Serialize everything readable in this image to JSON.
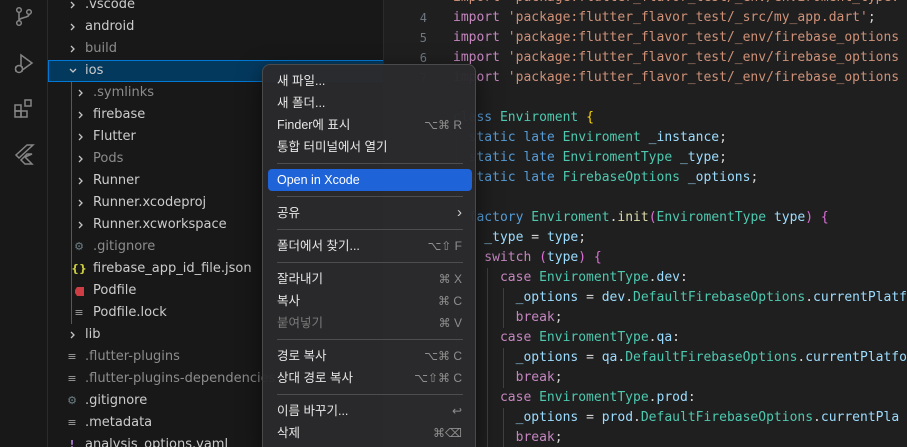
{
  "activity_bar": {
    "icons": [
      "source-control-icon",
      "run-debug-icon",
      "extensions-icon",
      "flutter-icon"
    ]
  },
  "explorer": {
    "items": [
      {
        "label": ".vscode"
      },
      {
        "label": "android"
      },
      {
        "label": "build"
      },
      {
        "label": "ios"
      },
      {
        "label": ".symlinks"
      },
      {
        "label": "firebase"
      },
      {
        "label": "Flutter"
      },
      {
        "label": "Pods"
      },
      {
        "label": "Runner"
      },
      {
        "label": "Runner.xcodeproj"
      },
      {
        "label": "Runner.xcworkspace"
      },
      {
        "label": ".gitignore",
        "icon": "⚙"
      },
      {
        "label": "firebase_app_id_file.json",
        "icon": "{}"
      },
      {
        "label": "Podfile"
      },
      {
        "label": "Podfile.lock",
        "icon": "≡"
      },
      {
        "label": "lib"
      },
      {
        "label": ".flutter-plugins",
        "icon": "≡"
      },
      {
        "label": ".flutter-plugins-dependencies",
        "icon": "≡"
      },
      {
        "label": ".gitignore",
        "icon": "⚙"
      },
      {
        "label": ".metadata",
        "icon": "≡"
      },
      {
        "label": "analysis_options.yaml",
        "icon": "!"
      }
    ]
  },
  "editor": {
    "line_numbers": [
      "4",
      "5",
      "6",
      "7"
    ],
    "lines": [
      [
        {
          "t": "import 'package:flutter_flavor_test/_env/enviroment_type.",
          "c": "st"
        }
      ],
      [
        {
          "t": "import ",
          "c": "kc"
        },
        {
          "t": "'package:flutter_flavor_test/_src/my_app.dart'",
          "c": "st"
        },
        {
          "t": ";",
          "c": "pn"
        }
      ],
      [
        {
          "t": "import ",
          "c": "kc"
        },
        {
          "t": "'package:flutter_flavor_test/_env/firebase_options",
          "c": "st"
        }
      ],
      [
        {
          "t": "import ",
          "c": "kc"
        },
        {
          "t": "'package:flutter_flavor_test/_env/firebase_options",
          "c": "st"
        }
      ],
      [
        {
          "t": "import ",
          "c": "kc"
        },
        {
          "t": "'package:flutter_flavor_test/_env/firebase_options",
          "c": "st"
        }
      ],
      [],
      [
        {
          "t": "class ",
          "c": "kw"
        },
        {
          "t": "Enviroment ",
          "c": "ty"
        },
        {
          "t": "{",
          "c": "pu"
        }
      ],
      [
        {
          "t": "  static late ",
          "c": "kw"
        },
        {
          "t": "Enviroment ",
          "c": "ty"
        },
        {
          "t": "_instance",
          "c": "vr"
        },
        {
          "t": ";",
          "c": "pn"
        }
      ],
      [
        {
          "t": "  static late ",
          "c": "kw"
        },
        {
          "t": "EnviromentType ",
          "c": "ty"
        },
        {
          "t": "_type",
          "c": "vr"
        },
        {
          "t": ";",
          "c": "pn"
        }
      ],
      [
        {
          "t": "  static late ",
          "c": "kw"
        },
        {
          "t": "FirebaseOptions ",
          "c": "ty"
        },
        {
          "t": "_options",
          "c": "vr"
        },
        {
          "t": ";",
          "c": "pn"
        }
      ],
      [],
      [
        {
          "t": "  factory ",
          "c": "kw"
        },
        {
          "t": "Enviroment",
          "c": "ty"
        },
        {
          "t": ".",
          "c": "pn"
        },
        {
          "t": "init",
          "c": "fn"
        },
        {
          "t": "(",
          "c": "pl"
        },
        {
          "t": "EnviromentType ",
          "c": "ty"
        },
        {
          "t": "type",
          "c": "vr"
        },
        {
          "t": ") ",
          "c": "pl"
        },
        {
          "t": "{",
          "c": "pl"
        }
      ],
      [
        {
          "t": "    _type ",
          "c": "vr"
        },
        {
          "t": "= ",
          "c": "pn"
        },
        {
          "t": "type",
          "c": "vr"
        },
        {
          "t": ";",
          "c": "pn"
        }
      ],
      [
        {
          "t": "    switch ",
          "c": "kc"
        },
        {
          "t": "(",
          "c": "pl"
        },
        {
          "t": "type",
          "c": "vr"
        },
        {
          "t": ") ",
          "c": "pl"
        },
        {
          "t": "{",
          "c": "pl"
        }
      ],
      [
        {
          "t": "      case ",
          "c": "kc"
        },
        {
          "t": "EnviromentType",
          "c": "ty"
        },
        {
          "t": ".",
          "c": "pn"
        },
        {
          "t": "dev",
          "c": "vr"
        },
        {
          "t": ":",
          "c": "pn"
        }
      ],
      [
        {
          "t": "        _options ",
          "c": "vr"
        },
        {
          "t": "= ",
          "c": "pn"
        },
        {
          "t": "dev",
          "c": "vr"
        },
        {
          "t": ".",
          "c": "pn"
        },
        {
          "t": "DefaultFirebaseOptions",
          "c": "ty"
        },
        {
          "t": ".",
          "c": "pn"
        },
        {
          "t": "currentPlatf",
          "c": "vr"
        }
      ],
      [
        {
          "t": "        break",
          "c": "kc"
        },
        {
          "t": ";",
          "c": "pn"
        }
      ],
      [
        {
          "t": "      case ",
          "c": "kc"
        },
        {
          "t": "EnviromentType",
          "c": "ty"
        },
        {
          "t": ".",
          "c": "pn"
        },
        {
          "t": "qa",
          "c": "vr"
        },
        {
          "t": ":",
          "c": "pn"
        }
      ],
      [
        {
          "t": "        _options ",
          "c": "vr"
        },
        {
          "t": "= ",
          "c": "pn"
        },
        {
          "t": "qa",
          "c": "vr"
        },
        {
          "t": ".",
          "c": "pn"
        },
        {
          "t": "DefaultFirebaseOptions",
          "c": "ty"
        },
        {
          "t": ".",
          "c": "pn"
        },
        {
          "t": "currentPlatfo",
          "c": "vr"
        }
      ],
      [
        {
          "t": "        break",
          "c": "kc"
        },
        {
          "t": ";",
          "c": "pn"
        }
      ],
      [
        {
          "t": "      case ",
          "c": "kc"
        },
        {
          "t": "EnviromentType",
          "c": "ty"
        },
        {
          "t": ".",
          "c": "pn"
        },
        {
          "t": "prod",
          "c": "vr"
        },
        {
          "t": ":",
          "c": "pn"
        }
      ],
      [
        {
          "t": "        _options ",
          "c": "vr"
        },
        {
          "t": "= ",
          "c": "pn"
        },
        {
          "t": "prod",
          "c": "vr"
        },
        {
          "t": ".",
          "c": "pn"
        },
        {
          "t": "DefaultFirebaseOptions",
          "c": "ty"
        },
        {
          "t": ".",
          "c": "pn"
        },
        {
          "t": "currentPla",
          "c": "vr"
        }
      ],
      [
        {
          "t": "        break",
          "c": "kc"
        },
        {
          "t": ";",
          "c": "pn"
        }
      ]
    ]
  },
  "context_menu": {
    "items": [
      {
        "label": "새 파일..."
      },
      {
        "label": "새 폴더..."
      },
      {
        "label": "Finder에 표시",
        "shortcut": "⌥⌘ R"
      },
      {
        "label": "통합 터미널에서 열기"
      },
      {
        "label": "Open in Xcode"
      },
      {
        "label": "공유",
        "shortcut": "›"
      },
      {
        "label": "폴더에서 찾기...",
        "shortcut": "⌥⇧ F"
      },
      {
        "label": "잘라내기",
        "shortcut": "⌘ X"
      },
      {
        "label": "복사",
        "shortcut": "⌘ C"
      },
      {
        "label": "붙여넣기",
        "shortcut": "⌘ V"
      },
      {
        "label": "경로 복사",
        "shortcut": "⌥⌘ C"
      },
      {
        "label": "상대 경로 복사",
        "shortcut": "⌥⇧⌘ C"
      },
      {
        "label": "이름 바꾸기...",
        "shortcut": "↩"
      },
      {
        "label": "삭제",
        "shortcut": "⌘⌫"
      }
    ]
  }
}
